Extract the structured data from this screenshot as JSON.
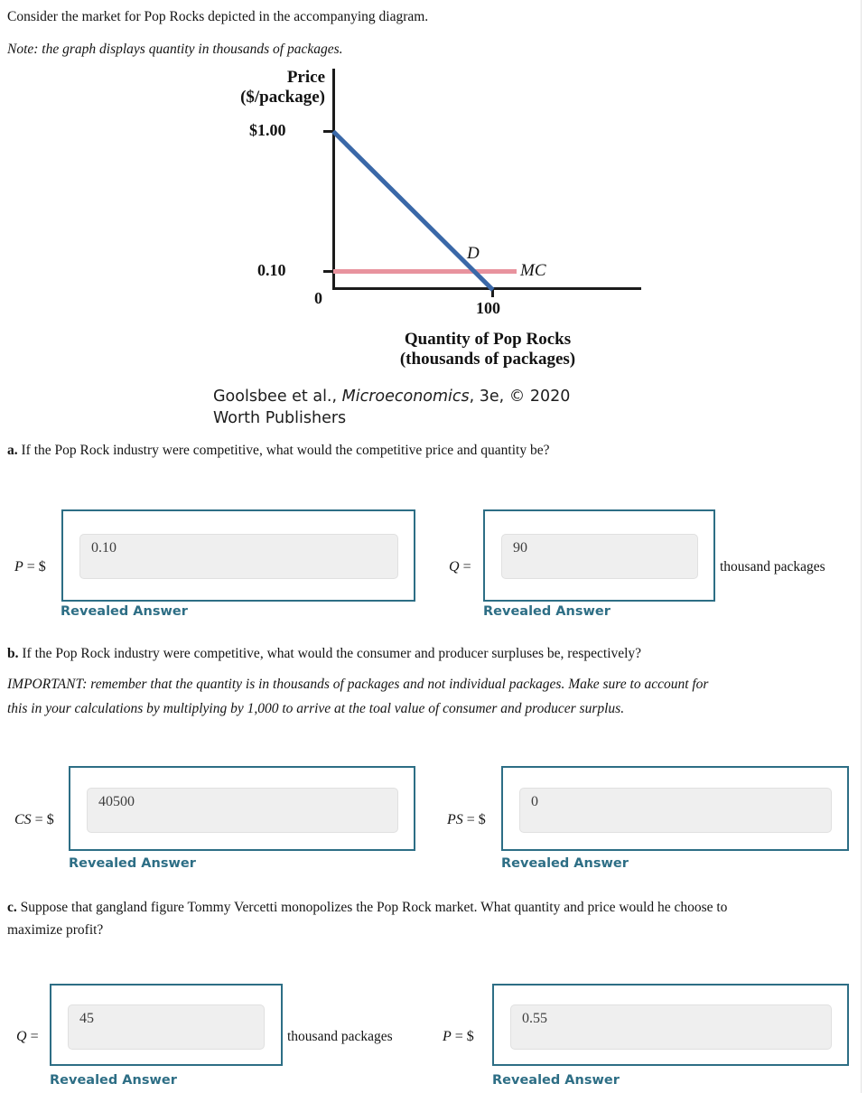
{
  "intro": {
    "line1": "Consider the market for Pop Rocks depicted in the accompanying diagram.",
    "note": "Note: the graph displays quantity in thousands of packages."
  },
  "chart_data": {
    "type": "line",
    "title": "",
    "ylabel": "Price ($/package)",
    "ylabel_line1": "Price",
    "ylabel_line2": "($/package)",
    "xlabel": "Quantity of Pop Rocks (thousands of packages)",
    "xlabel_line1": "Quantity of Pop Rocks",
    "xlabel_line2": "(thousands of packages)",
    "origin_label": "0",
    "yticks": [
      "$1.00",
      "0.10"
    ],
    "ytick_values": [
      1.0,
      0.1
    ],
    "xticks": [
      "100"
    ],
    "xtick_values": [
      100
    ],
    "xlim": [
      0,
      195
    ],
    "ylim": [
      0,
      1.0
    ],
    "grid": false,
    "legend": "inline",
    "series": [
      {
        "name": "D",
        "label": "D",
        "color": "#3a68a8",
        "x": [
          0,
          100
        ],
        "y": [
          1.0,
          0.0
        ],
        "description": "Demand curve, linear, P = 1.00 - 0.01Q"
      },
      {
        "name": "MC",
        "label": "MC",
        "color": "#e8939e",
        "x": [
          0,
          115
        ],
        "y": [
          0.1,
          0.1
        ],
        "description": "Marginal cost, constant at $0.10"
      }
    ],
    "attribution_line1_a": "Goolsbee et al., ",
    "attribution_line1_b": "Microeconomics",
    "attribution_line1_c": ", 3e, © 2020",
    "attribution_line2": "Worth Publishers"
  },
  "questions": [
    {
      "id": "a",
      "letter": "a.",
      "prompt": "If the Pop Rock industry were competitive, what would the competitive price and quantity be?",
      "fields": [
        {
          "label_pre": "P",
          "label_post": " = $",
          "value": "0.10",
          "placeholder": "",
          "unit": "",
          "revealed": "Revealed Answer"
        },
        {
          "label_pre": "Q",
          "label_post": " =",
          "value": "90",
          "placeholder": "",
          "unit": "thousand packages",
          "revealed": "Revealed Answer"
        }
      ]
    },
    {
      "id": "b",
      "letter": "b.",
      "prompt": "If the Pop Rock industry were competitive, what would the consumer and producer surpluses be, respectively?",
      "important_line1": "IMPORTANT: remember that the quantity is in thousands of packages and not individual packages. Make sure to account for",
      "important_line2": "this in your calculations by multiplying by 1,000 to arrive at the toal value of consumer and producer surplus.",
      "fields": [
        {
          "label_pre": "CS",
          "label_post": " = $",
          "value": "40500",
          "placeholder": "",
          "unit": "",
          "revealed": "Revealed Answer"
        },
        {
          "label_pre": "PS",
          "label_post": " = $",
          "value": "0",
          "placeholder": "",
          "unit": "",
          "revealed": "Revealed Answer"
        }
      ]
    },
    {
      "id": "c",
      "letter": "c.",
      "prompt_line1": "Suppose that gangland figure Tommy Vercetti monopolizes the Pop Rock market. What quantity and price would he choose to",
      "prompt_line2": "maximize profit?",
      "fields": [
        {
          "label_pre": "Q",
          "label_post": " =",
          "value": "45",
          "placeholder": "",
          "unit": "thousand packages",
          "revealed": "Revealed Answer"
        },
        {
          "label_pre": "P",
          "label_post": " = $",
          "value": "0.55",
          "placeholder": "",
          "unit": "",
          "revealed": "Revealed Answer"
        }
      ]
    }
  ],
  "colors": {
    "accent_teal": "#2d6e85",
    "demand_blue": "#3a68a8",
    "mc_pink": "#e8939e",
    "field_bg": "#efefef"
  }
}
